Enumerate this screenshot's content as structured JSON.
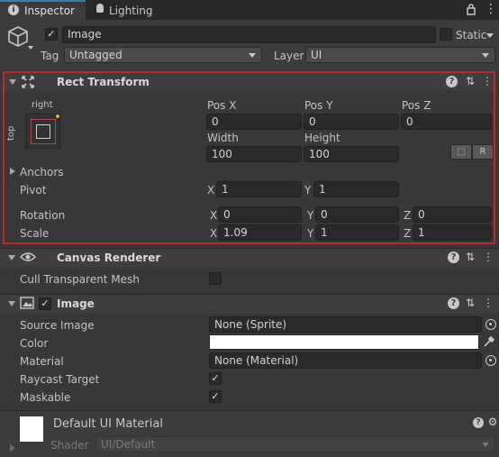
{
  "tabs": [
    {
      "label": "Inspector",
      "icon": "info-icon",
      "active": true
    },
    {
      "label": "Lighting",
      "icon": "lightbulb-icon",
      "active": false
    }
  ],
  "object": {
    "name": "Image",
    "static_label": "Static",
    "tag_label": "Tag",
    "tag_value": "Untagged",
    "layer_label": "Layer",
    "layer_value": "UI"
  },
  "rect_transform": {
    "title": "Rect Transform",
    "anchor_h": "right",
    "anchor_v": "top",
    "pos_x_label": "Pos X",
    "pos_y_label": "Pos Y",
    "pos_z_label": "Pos Z",
    "pos_x": "0",
    "pos_y": "0",
    "pos_z": "0",
    "width_label": "Width",
    "height_label": "Height",
    "width": "100",
    "height": "100",
    "blueprint_btn": "⬚",
    "raw_btn": "R",
    "anchors_label": "Anchors",
    "pivot_label": "Pivot",
    "pivot_x": "1",
    "pivot_y": "1",
    "rotation_label": "Rotation",
    "rot_x": "0",
    "rot_y": "0",
    "rot_z": "0",
    "scale_label": "Scale",
    "scale_x": "1.09",
    "scale_y": "1",
    "scale_z": "1",
    "axis_x": "X",
    "axis_y": "Y",
    "axis_z": "Z"
  },
  "canvas_renderer": {
    "title": "Canvas Renderer",
    "cull_label": "Cull Transparent Mesh"
  },
  "image": {
    "title": "Image",
    "source_label": "Source Image",
    "source_value": "None (Sprite)",
    "color_label": "Color",
    "color_value": "#ffffff",
    "material_label": "Material",
    "material_value": "None (Material)",
    "raycast_label": "Raycast Target",
    "maskable_label": "Maskable"
  },
  "material_preview": {
    "name": "Default UI Material",
    "shader_label": "Shader",
    "shader_value": "UI/Default"
  },
  "colors": {
    "highlight_border": "#c0282a",
    "background": "#383838"
  }
}
